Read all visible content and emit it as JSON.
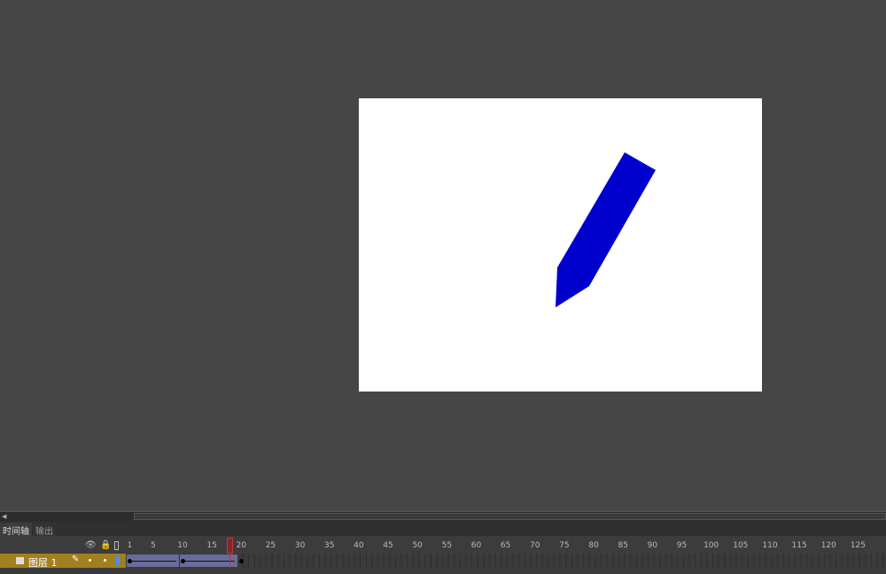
{
  "stage": {
    "background": "#ffffff",
    "shape": {
      "name": "pencil",
      "fill": "#0000cc"
    }
  },
  "timeline": {
    "tabs": [
      {
        "label": "时间轴",
        "active": true
      },
      {
        "label": "输出",
        "active": false
      }
    ],
    "header_icons": [
      "eye-icon",
      "lock-icon",
      "outline-icon"
    ],
    "ruler_labels": [
      "1",
      "5",
      "10",
      "15",
      "20",
      "25",
      "30",
      "35",
      "40",
      "45",
      "50",
      "55",
      "60",
      "65",
      "70",
      "75",
      "80",
      "85",
      "90",
      "95",
      "100",
      "105",
      "110",
      "115",
      "120",
      "125"
    ],
    "current_frame": 18,
    "layers": [
      {
        "name": "图层 1",
        "color": "#4a8cff",
        "tweens": [
          [
            1,
            9
          ],
          [
            10,
            19
          ]
        ],
        "keyframes": [
          1,
          10,
          20
        ]
      }
    ]
  }
}
